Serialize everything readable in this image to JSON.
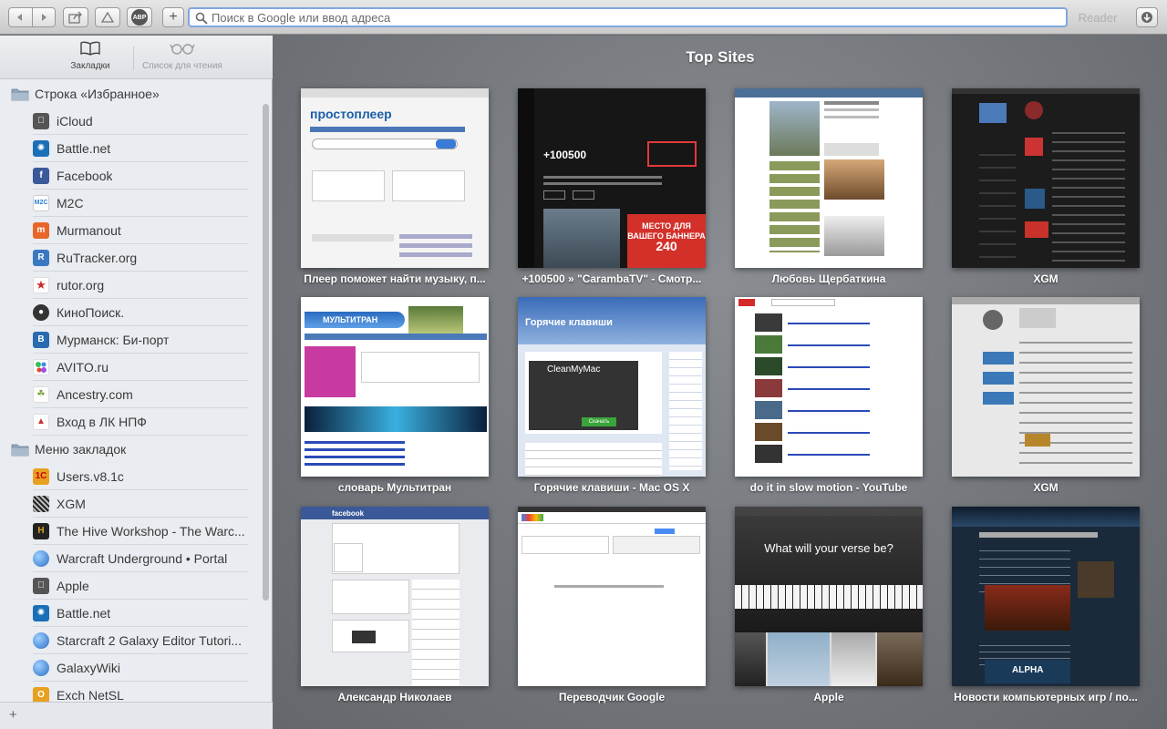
{
  "toolbar": {
    "address_placeholder": "Поиск в Google или ввод адреса",
    "reader_label": "Reader",
    "abp_label": "ABP",
    "new_tab_label": "+"
  },
  "sidebar": {
    "tab_bookmarks": "Закладки",
    "tab_reading_list": "Список для чтения",
    "folder_favorites": "Строка «Избранное»",
    "favorites": [
      {
        "label": "iCloud",
        "icon": "apple-icon",
        "color": "#555555"
      },
      {
        "label": "Battle.net",
        "icon": "battlenet-icon",
        "color": "#1b6fb8"
      },
      {
        "label": "Facebook",
        "icon": "facebook-icon",
        "color": "#3b5998"
      },
      {
        "label": "M2C",
        "icon": "m2c-icon",
        "color": "#2a7fd4"
      },
      {
        "label": "Murmanout",
        "icon": "murmanout-icon",
        "color": "#e8662a"
      },
      {
        "label": "RuTracker.org",
        "icon": "rutracker-icon",
        "color": "#3a78c2"
      },
      {
        "label": "rutor.org",
        "icon": "rutor-icon",
        "color": "#cc2a2a"
      },
      {
        "label": "КиноПоиск.",
        "icon": "kinopoisk-icon",
        "color": "#333333"
      },
      {
        "label": "Мурманск: Би-порт",
        "icon": "biport-icon",
        "color": "#2a6bb0"
      },
      {
        "label": "AVITO.ru",
        "icon": "avito-icon",
        "color": "#ffffff"
      },
      {
        "label": "Ancestry.com",
        "icon": "ancestry-icon",
        "color": "#9bbb59"
      },
      {
        "label": "Вход в ЛК НПФ",
        "icon": "npf-icon",
        "color": "#c83232"
      }
    ],
    "folder_menu": "Меню закладок",
    "menu": [
      {
        "label": "Users.v8.1c",
        "icon": "1c-icon",
        "color": "#e8a020"
      },
      {
        "label": "XGM",
        "icon": "xgm-icon",
        "color": "#222222"
      },
      {
        "label": "The Hive Workshop - The Warc...",
        "icon": "hive-icon",
        "color": "#d7a51e"
      },
      {
        "label": "Warcraft Underground • Portal",
        "icon": "globe-icon",
        "color": "#3a86d6"
      },
      {
        "label": "Apple",
        "icon": "apple-icon",
        "color": "#555555"
      },
      {
        "label": "Battle.net",
        "icon": "battlenet-icon",
        "color": "#1b6fb8"
      },
      {
        "label": "Starcraft 2 Galaxy Editor Tutori...",
        "icon": "globe-icon",
        "color": "#3a86d6"
      },
      {
        "label": "GalaxyWiki",
        "icon": "globe-icon",
        "color": "#3a86d6"
      },
      {
        "label": "Exch NetSL",
        "icon": "exch-icon",
        "color": "#e8a020"
      }
    ]
  },
  "top_sites": {
    "title": "Top Sites",
    "tiles": [
      {
        "caption": "Плеер поможет найти музыку, п..."
      },
      {
        "caption": "+100500 » \"CarambaTV\" - Смотр..."
      },
      {
        "caption": "Любовь Щербаткина"
      },
      {
        "caption": "XGM"
      },
      {
        "caption": "словарь Мультитран"
      },
      {
        "caption": "Горячие клавиши - Mac OS X"
      },
      {
        "caption": "do it in slow motion - YouTube"
      },
      {
        "caption": "XGM"
      },
      {
        "caption": "Александр Николаев"
      },
      {
        "caption": "Переводчик Google"
      },
      {
        "caption": "Apple"
      },
      {
        "caption": "Новости компьютерных игр / по..."
      }
    ],
    "thumb_texts": {
      "prostopleer": "простоплеер",
      "caramba_number": "+100500",
      "caramba_banner": "МЕСТО ДЛЯ ВАШЕГО БАННЕРА",
      "caramba_price": "240",
      "multitran": "МУЛЬТИТРАН",
      "hotkeys": "Горячие клавиши",
      "cleanmymac": "CleanMyMac",
      "cleanmymac_btn": "Скачать",
      "facebook": "facebook",
      "apple_headline": "What will your verse be?",
      "alpha": "ALPHA"
    }
  }
}
